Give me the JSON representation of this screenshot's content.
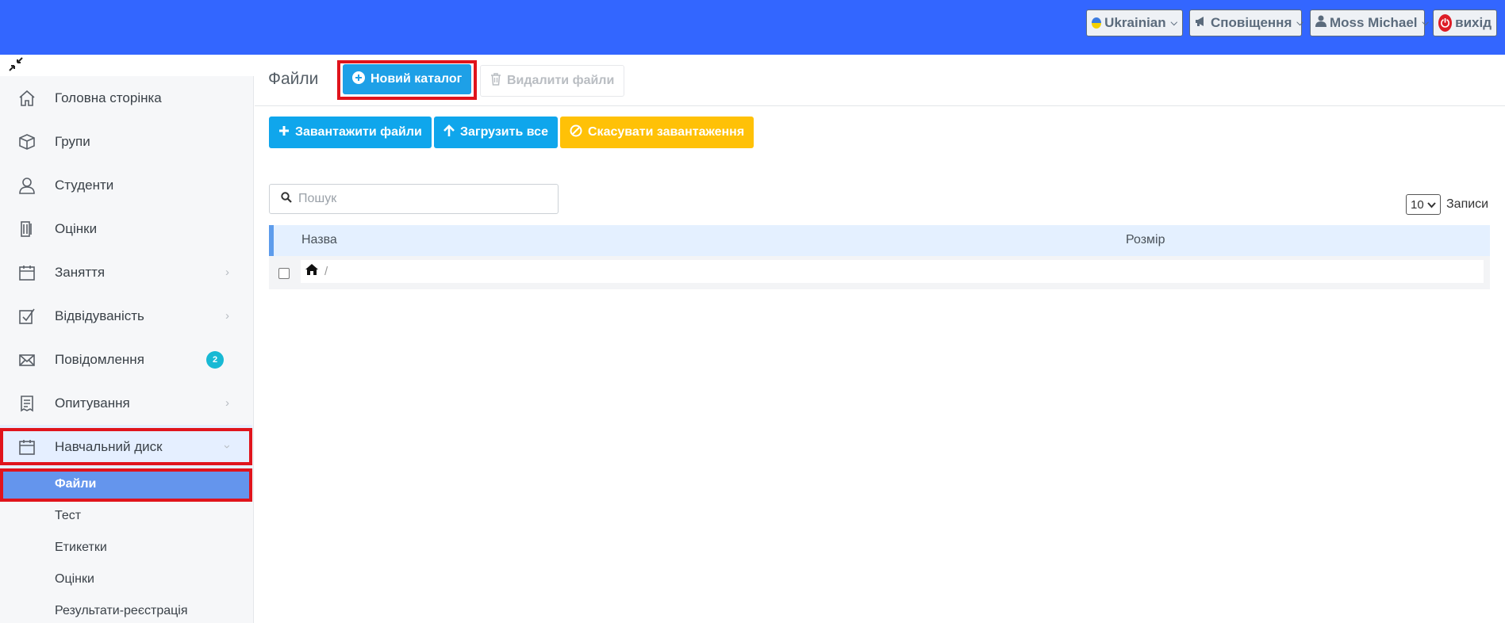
{
  "topbar": {
    "language": "Ukrainian",
    "notifications": "Сповіщення",
    "user": "Moss Michael",
    "logout": "вихід",
    "colors": {
      "bar": "#3366ff",
      "logout_icon": "#dd1d27"
    }
  },
  "sidebar": {
    "items": [
      {
        "label": "Головна сторінка",
        "icon": "home-icon"
      },
      {
        "label": "Групи",
        "icon": "cube-icon"
      },
      {
        "label": "Студенти",
        "icon": "user-icon"
      },
      {
        "label": "Оцінки",
        "icon": "grades-icon"
      },
      {
        "label": "Заняття",
        "icon": "calendar-icon",
        "has_children": true
      },
      {
        "label": "Відвідуваність",
        "icon": "checkbox-icon",
        "has_children": true
      },
      {
        "label": "Повідомлення",
        "icon": "envelope-icon",
        "badge": "2"
      },
      {
        "label": "Опитування",
        "icon": "receipt-icon",
        "has_children": true
      },
      {
        "label": "Навчальний диск",
        "icon": "calendar-icon",
        "has_children": true,
        "expanded": true
      }
    ],
    "subitems": [
      {
        "label": "Файли",
        "active": true
      },
      {
        "label": "Тест"
      },
      {
        "label": "Етикетки"
      },
      {
        "label": "Оцінки"
      },
      {
        "label": "Результати-реєстрація"
      }
    ]
  },
  "main": {
    "title": "Файли",
    "new_folder": "Новий каталог",
    "delete_files": "Видалити файли",
    "upload_files": "Завантажити файли",
    "upload_all": "Загрузить все",
    "cancel_upload": "Скасувати завантаження",
    "search_placeholder": "Пошук",
    "per_page": "10",
    "per_page_label": "Записи",
    "table": {
      "columns": [
        "Назва",
        "Розмір"
      ],
      "path_separator": "/"
    }
  }
}
